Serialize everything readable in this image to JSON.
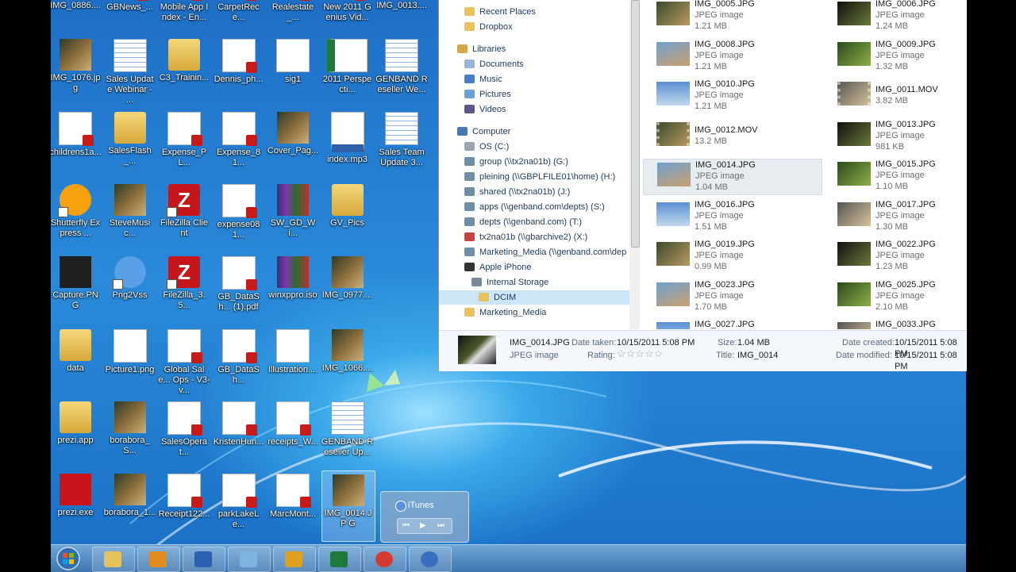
{
  "desktop_icons": [
    {
      "label": "IMG_0886....",
      "kind": "photo"
    },
    {
      "label": "GBNews_...",
      "kind": "pdf"
    },
    {
      "label": "Mobile App Index - En...",
      "kind": "pdf"
    },
    {
      "label": "CarpetRece...",
      "kind": "pdf"
    },
    {
      "label": "Realestate_...",
      "kind": "pdf"
    },
    {
      "label": "New 2011 Genius Vid...",
      "kind": "pdf"
    },
    {
      "label": "IMG_0013....",
      "kind": "photo"
    },
    {
      "label": "IMG_1076.jpg",
      "kind": "photo"
    },
    {
      "label": "Sales Update Webinar - ...",
      "kind": "cal"
    },
    {
      "label": "C3_Trainin...",
      "kind": "zip"
    },
    {
      "label": "Dennis_ph...",
      "kind": "pdf"
    },
    {
      "label": "sig1",
      "kind": "page"
    },
    {
      "label": "2011 Perspecti...",
      "kind": "xls"
    },
    {
      "label": "GENBAND Reseller We...",
      "kind": "cal"
    },
    {
      "label": "childrens1a...",
      "kind": "pdf"
    },
    {
      "label": "SalesFlash_...",
      "kind": "zip"
    },
    {
      "label": "Expense_PL...",
      "kind": "pdf"
    },
    {
      "label": "Expense_81...",
      "kind": "pdf"
    },
    {
      "label": "Cover_Pag...",
      "kind": "photo"
    },
    {
      "label": "index.mp3",
      "kind": "mp3"
    },
    {
      "label": "Sales Team Update 3...",
      "kind": "cal"
    },
    {
      "label": "Shutterfly Express ...",
      "kind": "shutterfly"
    },
    {
      "label": "SteveMusic...",
      "kind": "photo"
    },
    {
      "label": "FileZilla Client",
      "kind": "fz"
    },
    {
      "label": "expense081...",
      "kind": "pdf"
    },
    {
      "label": "SW_GD_Wi...",
      "kind": "rar"
    },
    {
      "label": "GV_Pics",
      "kind": "folder"
    },
    {
      "label": "",
      "kind": "none"
    },
    {
      "label": "Capture.PNG",
      "kind": "dark"
    },
    {
      "label": "Png2Vss",
      "kind": "gear"
    },
    {
      "label": "FileZilla_3.5...",
      "kind": "fz"
    },
    {
      "label": "GB_DataSh... (1).pdf",
      "kind": "pdf"
    },
    {
      "label": "winxppro.iso",
      "kind": "rar"
    },
    {
      "label": "IMG_0977....",
      "kind": "photo"
    },
    {
      "label": "",
      "kind": "none"
    },
    {
      "label": "data",
      "kind": "folder"
    },
    {
      "label": "Picture1.png",
      "kind": "page"
    },
    {
      "label": "Global Sale... Ops - V3-v...",
      "kind": "pdf"
    },
    {
      "label": "GB_DataSh...",
      "kind": "pdf"
    },
    {
      "label": "Illustration....",
      "kind": "page"
    },
    {
      "label": "IMG_1066....",
      "kind": "photo"
    },
    {
      "label": "",
      "kind": "none"
    },
    {
      "label": "prezi.app",
      "kind": "folder"
    },
    {
      "label": "borabora_S...",
      "kind": "photo"
    },
    {
      "label": "SalesOperat...",
      "kind": "pdf"
    },
    {
      "label": "KristenHun...",
      "kind": "pdf"
    },
    {
      "label": "receipts_W...",
      "kind": "pdf"
    },
    {
      "label": "GENBAND Reseller Up...",
      "kind": "cal"
    },
    {
      "label": "",
      "kind": "none"
    },
    {
      "label": "prezi.exe",
      "kind": "flash"
    },
    {
      "label": "borabora_1...",
      "kind": "photo"
    },
    {
      "label": "Receipt122...",
      "kind": "pdf"
    },
    {
      "label": "parkLakeLe...",
      "kind": "pdf"
    },
    {
      "label": "MarcMont...",
      "kind": "pdf"
    },
    {
      "label": "IMG_0014.JP G",
      "kind": "photo",
      "selected": true
    },
    {
      "label": "",
      "kind": "none"
    }
  ],
  "explorer": {
    "nav": [
      {
        "label": "Recent Places",
        "icon": "folder"
      },
      {
        "label": "Dropbox",
        "icon": "folder"
      },
      {
        "label": "Libraries",
        "icon": "library",
        "head": true
      },
      {
        "label": "Documents",
        "icon": "doc"
      },
      {
        "label": "Music",
        "icon": "music"
      },
      {
        "label": "Pictures",
        "icon": "pics"
      },
      {
        "label": "Videos",
        "icon": "video"
      },
      {
        "label": "Computer",
        "icon": "computer",
        "head": true
      },
      {
        "label": "OS (C:)",
        "icon": "drive"
      },
      {
        "label": "group (\\\\tx2na01b) (G:)",
        "icon": "net"
      },
      {
        "label": "pleining (\\\\GBPLFILE01\\home) (H:)",
        "icon": "net"
      },
      {
        "label": "shared (\\\\tx2na01b) (J:)",
        "icon": "net"
      },
      {
        "label": "apps (\\\\genband.com\\depts) (S:)",
        "icon": "net"
      },
      {
        "label": "depts (\\\\genband.com) (T:)",
        "icon": "net"
      },
      {
        "label": "tx2na01b (\\\\gbarchive2) (X:)",
        "icon": "netx"
      },
      {
        "label": "Marketing_Media (\\\\genband.com\\dep",
        "icon": "net"
      },
      {
        "label": "Apple iPhone",
        "icon": "phone"
      },
      {
        "label": "Internal Storage",
        "icon": "storage",
        "indent": 1
      },
      {
        "label": "DCIM",
        "icon": "folder",
        "indent": 2,
        "selected": true
      },
      {
        "label": "Marketing_Media",
        "icon": "folder"
      }
    ],
    "files": [
      {
        "name": "IMG_0005.JPG",
        "type": "JPEG image",
        "size": "1.21 MB"
      },
      {
        "name": "IMG_0006.JPG",
        "type": "JPEG image",
        "size": "1.24 MB"
      },
      {
        "name": "IMG_0008.JPG",
        "type": "JPEG image",
        "size": "1.21 MB"
      },
      {
        "name": "IMG_0009.JPG",
        "type": "JPEG image",
        "size": "1.32 MB"
      },
      {
        "name": "IMG_0010.JPG",
        "type": "JPEG image",
        "size": "1.21 MB"
      },
      {
        "name": "IMG_0011.MOV",
        "type": "",
        "size": "3.82 MB",
        "mov": true
      },
      {
        "name": "IMG_0012.MOV",
        "type": "",
        "size": "13.2 MB",
        "mov": true
      },
      {
        "name": "IMG_0013.JPG",
        "type": "JPEG image",
        "size": "981 KB"
      },
      {
        "name": "IMG_0014.JPG",
        "type": "JPEG image",
        "size": "1.04 MB",
        "selected": true
      },
      {
        "name": "IMG_0015.JPG",
        "type": "JPEG image",
        "size": "1.10 MB"
      },
      {
        "name": "IMG_0016.JPG",
        "type": "JPEG image",
        "size": "1.51 MB"
      },
      {
        "name": "IMG_0017.JPG",
        "type": "JPEG image",
        "size": "1.30 MB"
      },
      {
        "name": "IMG_0019.JPG",
        "type": "JPEG image",
        "size": "0.99 MB"
      },
      {
        "name": "IMG_0022.JPG",
        "type": "JPEG image",
        "size": "1.23 MB"
      },
      {
        "name": "IMG_0023.JPG",
        "type": "JPEG image",
        "size": "1.70 MB"
      },
      {
        "name": "IMG_0025.JPG",
        "type": "JPEG image",
        "size": "2.10 MB"
      },
      {
        "name": "IMG_0027.JPG",
        "type": "",
        "size": ""
      },
      {
        "name": "IMG_0033.JPG",
        "type": "",
        "size": ""
      }
    ],
    "details": {
      "name": "IMG_0014.JPG",
      "type": "JPEG image",
      "date_taken_label": "Date taken:",
      "date_taken": "10/15/2011 5:08 PM",
      "rating_label": "Rating:",
      "stars": "☆☆☆☆☆",
      "size_label": "Size:",
      "size": "1.04 MB",
      "title_label": "Title:",
      "title": "IMG_0014",
      "created_label": "Date created:",
      "created": "10/15/2011 5:08 PM",
      "modified_label": "Date modified:",
      "modified": "10/15/2011 5:08 PM"
    }
  },
  "itunes_thumb": {
    "title": "iTunes"
  },
  "taskbar": {
    "items": [
      "explorer",
      "media-player",
      "word",
      "window",
      "outlook",
      "excel",
      "chrome",
      "itunes"
    ]
  }
}
